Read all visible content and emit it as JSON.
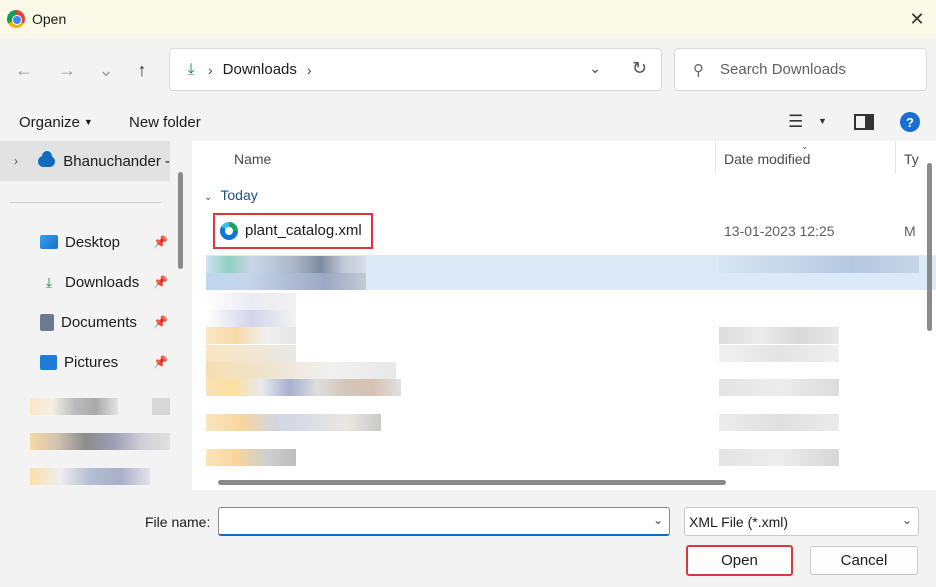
{
  "window": {
    "title": "Open",
    "close_glyph": "✕"
  },
  "nav": {
    "back_glyph": "←",
    "forward_glyph": "→",
    "recent_glyph": "⌄",
    "up_glyph": "↑",
    "address": {
      "location": "Downloads",
      "icon": "download-arrow-icon"
    },
    "search_placeholder": "Search Downloads"
  },
  "toolbar": {
    "organize_label": "Organize",
    "new_folder_label": "New folder"
  },
  "sidebar": {
    "onedrive_label": "Bhanuchander -",
    "items": [
      {
        "label": "Desktop",
        "icon": "desktop-icon"
      },
      {
        "label": "Downloads",
        "icon": "downloads-icon"
      },
      {
        "label": "Documents",
        "icon": "documents-icon"
      },
      {
        "label": "Pictures",
        "icon": "pictures-icon"
      }
    ]
  },
  "file_list": {
    "columns": [
      "Name",
      "Date modified",
      "Ty"
    ],
    "group_label": "Today",
    "files": [
      {
        "name": "plant_catalog.xml",
        "date_modified": "13-01-2023 12:25",
        "type": "M"
      }
    ]
  },
  "footer": {
    "file_name_label": "File name:",
    "file_name_value": "",
    "file_type_value": "XML File (*.xml)",
    "open_label": "Open",
    "cancel_label": "Cancel"
  },
  "colors": {
    "accent": "#0f6cbd",
    "highlight_box": "#d9363e",
    "selection": "#dce9f7"
  }
}
